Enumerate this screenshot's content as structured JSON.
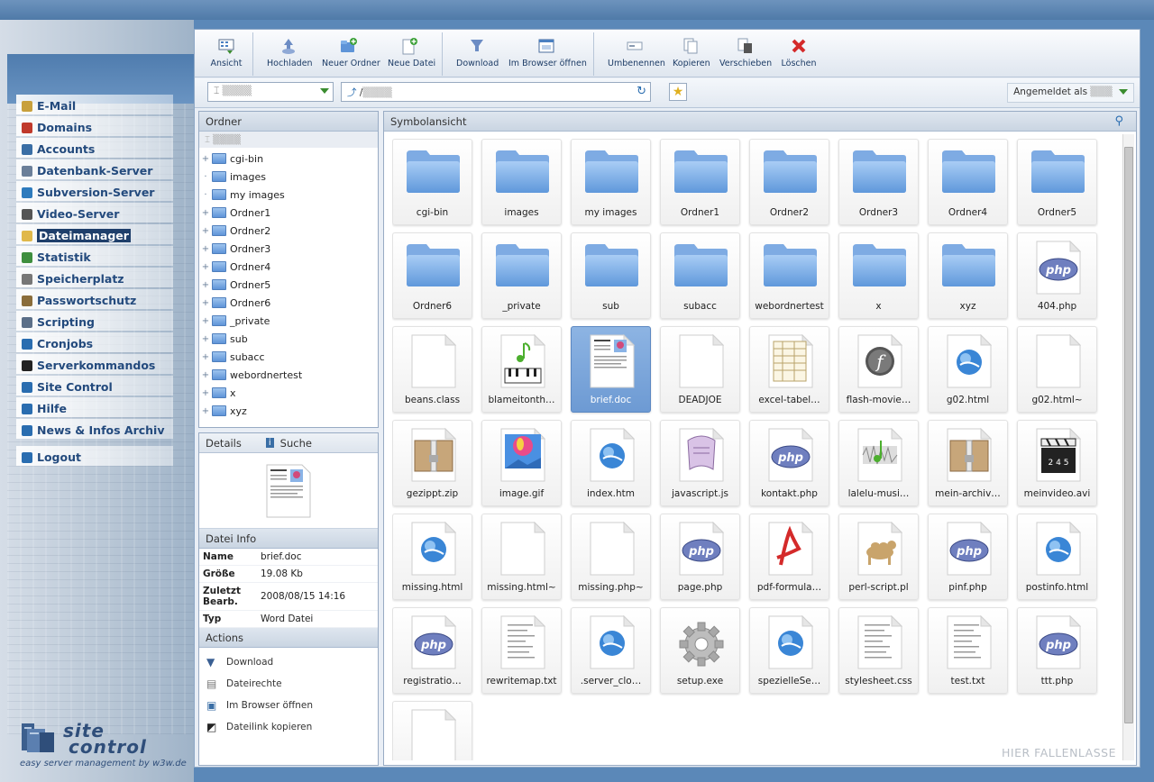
{
  "window": {
    "title": "site control"
  },
  "menu": [
    {
      "label": "E-Mail",
      "icon": "envelope-icon",
      "color": "#c8a03c"
    },
    {
      "label": "Domains",
      "icon": "domains-icon",
      "color": "#c0392b"
    },
    {
      "label": "Accounts",
      "icon": "accounts-icon",
      "color": "#3a6ea5"
    },
    {
      "label": "Datenbank-Server",
      "icon": "database-icon",
      "color": "#6b7f99"
    },
    {
      "label": "Subversion-Server",
      "icon": "subversion-icon",
      "color": "#2e7bbd"
    },
    {
      "label": "Video-Server",
      "icon": "video-icon",
      "color": "#555555"
    },
    {
      "label": "Dateimanager",
      "icon": "folder-icon",
      "color": "#e0b84a"
    },
    {
      "label": "Statistik",
      "icon": "chart-icon",
      "color": "#3e8e3e"
    },
    {
      "label": "Speicherplatz",
      "icon": "disk-icon",
      "color": "#777777"
    },
    {
      "label": "Passwortschutz",
      "icon": "key-icon",
      "color": "#8a6d3b"
    },
    {
      "label": "Scripting",
      "icon": "script-icon",
      "color": "#5b6f88"
    },
    {
      "label": "Cronjobs",
      "icon": "clock-icon",
      "color": "#2a6db0"
    },
    {
      "label": "Serverkommandos",
      "icon": "terminal-icon",
      "color": "#222222"
    },
    {
      "label": "Site Control",
      "icon": "site-control-icon",
      "color": "#2a6db0"
    },
    {
      "label": "Hilfe",
      "icon": "help-icon",
      "color": "#2a6db0"
    },
    {
      "label": "News & Infos Archiv",
      "icon": "info-icon",
      "color": "#2a6db0"
    },
    {
      "label": "Logout",
      "icon": "logout-icon",
      "color": "#2a6db0"
    }
  ],
  "menu_active": "Dateimanager",
  "logo": {
    "line1": "site",
    "line2": "control",
    "tagline": "easy server management by w3w.de"
  },
  "toolbar": {
    "view": "Ansicht",
    "upload": "Hochladen",
    "new_folder": "Neuer Ordner",
    "new_file": "Neue Datei",
    "download": "Download",
    "open_browser": "Im Browser öffnen",
    "rename": "Umbenennen",
    "copy": "Kopieren",
    "move": "Verschieben",
    "delete": "Löschen"
  },
  "address": {
    "path_prefix": "/",
    "logged_in_label": "Angemeldet als"
  },
  "folders_panel": {
    "title": "Ordner",
    "items": [
      {
        "label": "cgi-bin",
        "expandable": true
      },
      {
        "label": "images",
        "expandable": false
      },
      {
        "label": "my images",
        "expandable": false
      },
      {
        "label": "Ordner1",
        "expandable": true
      },
      {
        "label": "Ordner2",
        "expandable": true
      },
      {
        "label": "Ordner3",
        "expandable": true
      },
      {
        "label": "Ordner4",
        "expandable": true
      },
      {
        "label": "Ordner5",
        "expandable": true
      },
      {
        "label": "Ordner6",
        "expandable": true
      },
      {
        "label": "_private",
        "expandable": true
      },
      {
        "label": "sub",
        "expandable": true
      },
      {
        "label": "subacc",
        "expandable": true
      },
      {
        "label": "webordnertest",
        "expandable": true
      },
      {
        "label": "x",
        "expandable": true
      },
      {
        "label": "xyz",
        "expandable": true
      }
    ]
  },
  "details_panel": {
    "tab_details": "Details",
    "tab_search": "Suche",
    "info_title": "Datei Info",
    "info": [
      {
        "key": "Name",
        "value": "brief.doc"
      },
      {
        "key": "Größe",
        "value": "19.08 Kb"
      },
      {
        "key": "Zuletzt Bearb.",
        "value": "2008/08/15 14:16"
      },
      {
        "key": "Typ",
        "value": "Word Datei"
      }
    ],
    "actions_title": "Actions",
    "actions": [
      {
        "label": "Download",
        "icon": "download-icon"
      },
      {
        "label": "Dateirechte",
        "icon": "permissions-icon"
      },
      {
        "label": "Im Browser öffnen",
        "icon": "browser-icon"
      },
      {
        "label": "Dateilink kopieren",
        "icon": "link-copy-icon"
      }
    ]
  },
  "icon_view": {
    "title": "Symbolansicht",
    "drop_hint": "HIER FALLENLASSE",
    "items": [
      {
        "label": "cgi-bin",
        "kind": "folder"
      },
      {
        "label": "images",
        "kind": "folder"
      },
      {
        "label": "my images",
        "kind": "folder"
      },
      {
        "label": "Ordner1",
        "kind": "folder"
      },
      {
        "label": "Ordner2",
        "kind": "folder"
      },
      {
        "label": "Ordner3",
        "kind": "folder"
      },
      {
        "label": "Ordner4",
        "kind": "folder"
      },
      {
        "label": "Ordner5",
        "kind": "folder"
      },
      {
        "label": "Ordner6",
        "kind": "folder"
      },
      {
        "label": "_private",
        "kind": "folder"
      },
      {
        "label": "sub",
        "kind": "folder"
      },
      {
        "label": "subacc",
        "kind": "folder"
      },
      {
        "label": "webordnertest",
        "kind": "folder"
      },
      {
        "label": "x",
        "kind": "folder"
      },
      {
        "label": "xyz",
        "kind": "folder"
      },
      {
        "label": "404.php",
        "kind": "php"
      },
      {
        "label": "beans.class",
        "kind": "blank"
      },
      {
        "label": "blameitonth…",
        "kind": "music"
      },
      {
        "label": "brief.doc",
        "kind": "doc",
        "selected": true
      },
      {
        "label": "DEADJOE",
        "kind": "blank"
      },
      {
        "label": "excel-tabel…",
        "kind": "excel"
      },
      {
        "label": "flash-movie…",
        "kind": "flash"
      },
      {
        "label": "g02.html",
        "kind": "html"
      },
      {
        "label": "g02.html~",
        "kind": "blank"
      },
      {
        "label": "gezippt.zip",
        "kind": "zip"
      },
      {
        "label": "image.gif",
        "kind": "image"
      },
      {
        "label": "index.htm",
        "kind": "html"
      },
      {
        "label": "javascript.js",
        "kind": "script"
      },
      {
        "label": "kontakt.php",
        "kind": "php"
      },
      {
        "label": "lalelu-musi…",
        "kind": "audio"
      },
      {
        "label": "mein-archiv…",
        "kind": "zip"
      },
      {
        "label": "meinvideo.avi",
        "kind": "video"
      },
      {
        "label": "missing.html",
        "kind": "html"
      },
      {
        "label": "missing.html~",
        "kind": "blank"
      },
      {
        "label": "missing.php~",
        "kind": "blank"
      },
      {
        "label": "page.php",
        "kind": "php"
      },
      {
        "label": "pdf-formula…",
        "kind": "pdf"
      },
      {
        "label": "perl-script.pl",
        "kind": "perl"
      },
      {
        "label": "pinf.php",
        "kind": "php"
      },
      {
        "label": "postinfo.html",
        "kind": "html"
      },
      {
        "label": "registratio…",
        "kind": "php"
      },
      {
        "label": "rewritemap.txt",
        "kind": "text"
      },
      {
        "label": ".server_clo…",
        "kind": "html"
      },
      {
        "label": "setup.exe",
        "kind": "exe"
      },
      {
        "label": "spezielleSe…",
        "kind": "html"
      },
      {
        "label": "stylesheet.css",
        "kind": "text"
      },
      {
        "label": "test.txt",
        "kind": "text"
      },
      {
        "label": "ttt.php",
        "kind": "php"
      },
      {
        "label": "",
        "kind": "blank"
      }
    ]
  }
}
